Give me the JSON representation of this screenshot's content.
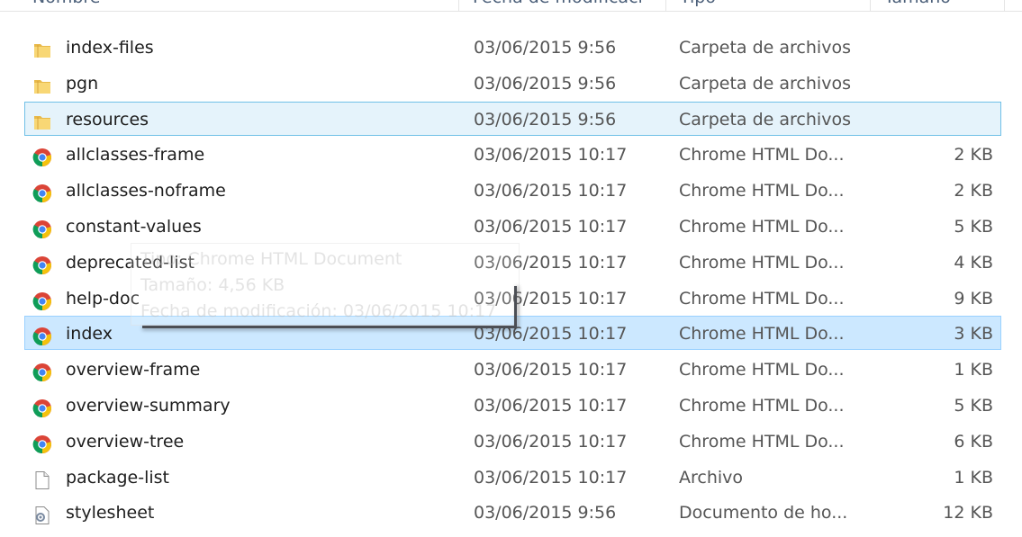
{
  "columns": {
    "name": "Nombre",
    "date": "Fecha de modificaci",
    "type": "Tipo",
    "size": "Tamaño"
  },
  "files": [
    {
      "name": "index-files",
      "date": "03/06/2015 9:56",
      "type": "Carpeta de archivos",
      "size": "",
      "icon": "folder-icon"
    },
    {
      "name": "pgn",
      "date": "03/06/2015 9:56",
      "type": "Carpeta de archivos",
      "size": "",
      "icon": "folder-icon"
    },
    {
      "name": "resources",
      "date": "03/06/2015 9:56",
      "type": "Carpeta de archivos",
      "size": "",
      "icon": "folder-icon"
    },
    {
      "name": "allclasses-frame",
      "date": "03/06/2015 10:17",
      "type": "Chrome HTML Do...",
      "size": "2 KB",
      "icon": "chrome-icon"
    },
    {
      "name": "allclasses-noframe",
      "date": "03/06/2015 10:17",
      "type": "Chrome HTML Do...",
      "size": "2 KB",
      "icon": "chrome-icon"
    },
    {
      "name": "constant-values",
      "date": "03/06/2015 10:17",
      "type": "Chrome HTML Do...",
      "size": "5 KB",
      "icon": "chrome-icon"
    },
    {
      "name": "deprecated-list",
      "date": "03/06/2015 10:17",
      "type": "Chrome HTML Do...",
      "size": "4 KB",
      "icon": "chrome-icon"
    },
    {
      "name": "help-doc",
      "date": "03/06/2015 10:17",
      "type": "Chrome HTML Do...",
      "size": "9 KB",
      "icon": "chrome-icon"
    },
    {
      "name": "index",
      "date": "03/06/2015 10:17",
      "type": "Chrome HTML Do...",
      "size": "3 KB",
      "icon": "chrome-icon"
    },
    {
      "name": "overview-frame",
      "date": "03/06/2015 10:17",
      "type": "Chrome HTML Do...",
      "size": "1 KB",
      "icon": "chrome-icon"
    },
    {
      "name": "overview-summary",
      "date": "03/06/2015 10:17",
      "type": "Chrome HTML Do...",
      "size": "5 KB",
      "icon": "chrome-icon"
    },
    {
      "name": "overview-tree",
      "date": "03/06/2015 10:17",
      "type": "Chrome HTML Do...",
      "size": "6 KB",
      "icon": "chrome-icon"
    },
    {
      "name": "package-list",
      "date": "03/06/2015 10:17",
      "type": "Archivo",
      "size": "1 KB",
      "icon": "blank-file-icon"
    },
    {
      "name": "stylesheet",
      "date": "03/06/2015 9:56",
      "type": "Documento de ho...",
      "size": "12 KB",
      "icon": "stylesheet-file-icon"
    }
  ],
  "tooltip": {
    "type_line": "Tipo: Chrome HTML Document",
    "size_line": "Tamaño: 4,56 KB",
    "date_line": "Fecha de modificación: 03/06/2015 10:17"
  },
  "colors": {
    "hover_bg": "#e5f3fb",
    "hover_border": "#70c0e7",
    "selected_bg": "#cce8ff",
    "selected_border": "#99d1ff"
  }
}
